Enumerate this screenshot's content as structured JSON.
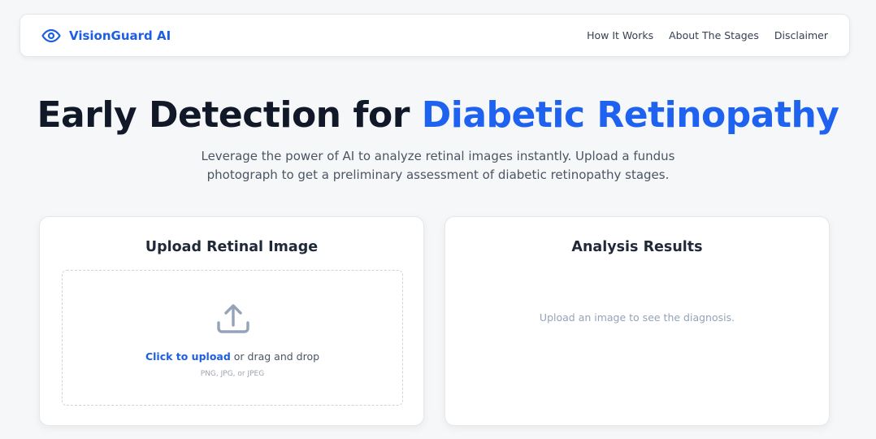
{
  "nav": {
    "brand": "VisionGuard AI",
    "brand_icon": "eye-icon",
    "links": [
      "How It Works",
      "About The Stages",
      "Disclaimer"
    ]
  },
  "hero": {
    "title_main": "Early Detection for ",
    "title_accent": "Diabetic Retinopathy",
    "subtitle": "Leverage the power of AI to analyze retinal images instantly. Upload a fundus photograph to get a preliminary assessment of diabetic retinopathy stages."
  },
  "upload": {
    "title": "Upload Retinal Image",
    "icon": "upload-icon",
    "link_text": "Click to upload",
    "rest_text": " or drag and drop",
    "hint": "PNG, JPG, or JPEG"
  },
  "results": {
    "title": "Analysis Results",
    "placeholder": "Upload an image to see the diagnosis."
  },
  "colors": {
    "accent": "#1f62f0",
    "brand": "#1d5ee3",
    "background": "#f6f7f9",
    "icon_gray": "#94a3b8"
  }
}
